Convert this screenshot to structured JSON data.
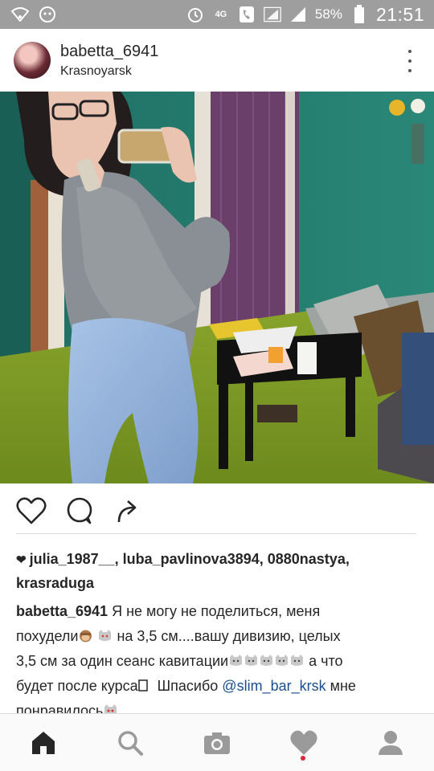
{
  "status_bar": {
    "network": "4G",
    "battery": "58%",
    "time": "21:51"
  },
  "post": {
    "username": "babetta_6941",
    "location": "Krasnoyarsk"
  },
  "likes": {
    "users": "julia_1987__, luba_pavlinova3894, 0880nastya,",
    "users_cont": "krasraduga"
  },
  "caption": {
    "user": "babetta_6941",
    "line1": " Я не могу не поделиться, меня",
    "line2a": "похудели",
    "line2b": " на 3,5 см....вашу дивизию, целых",
    "line3a": "3,5 см за один сеанс кавитации",
    "line3b": " а что",
    "line4a": "будет после курса",
    "line4b": " Шпасибо ",
    "mention": "@slim_bar_krsk",
    "line4c": " мне",
    "line5": "понравилось"
  },
  "icons": {
    "like": "heart-outline-icon",
    "comment": "comment-bubble-icon",
    "share": "share-arrow-icon",
    "nav": [
      "home-icon",
      "search-icon",
      "camera-icon",
      "activity-heart-icon",
      "profile-icon"
    ]
  },
  "colors": {
    "status_bar": "#9e9e9e",
    "mention": "#1b4f8f",
    "notification_dot": "#e0263a"
  }
}
